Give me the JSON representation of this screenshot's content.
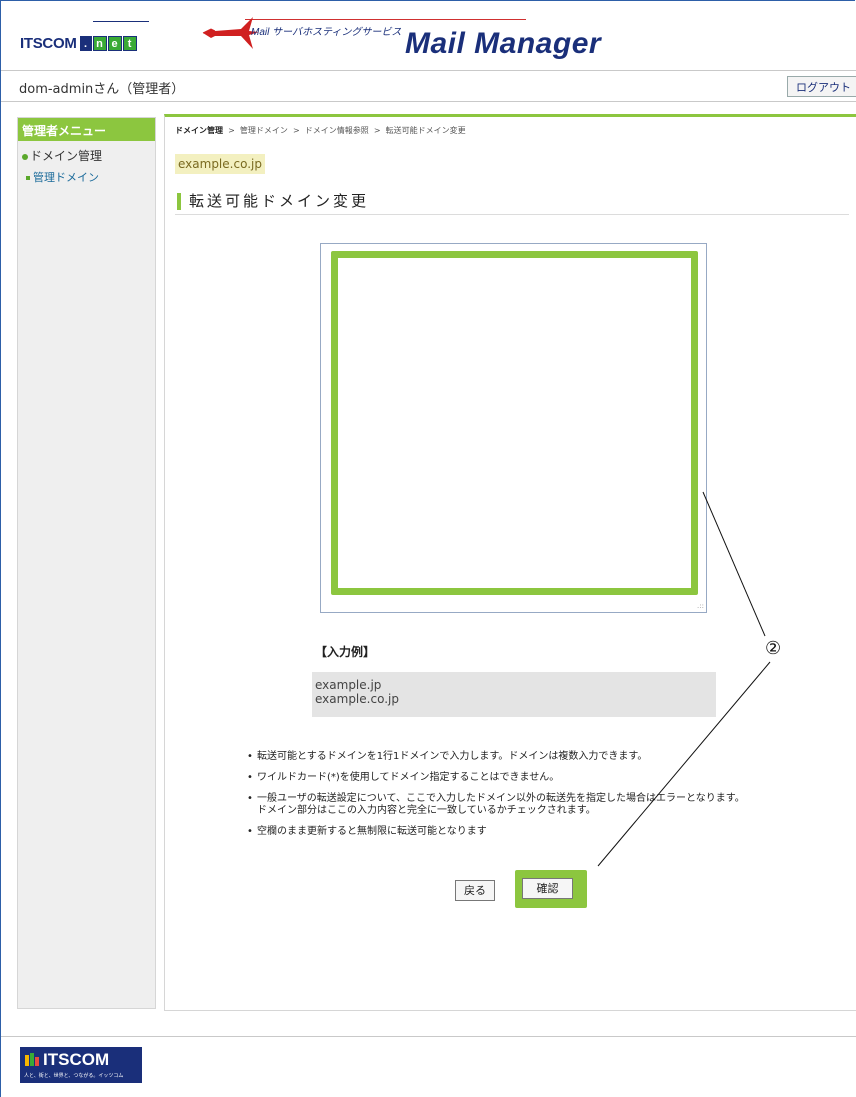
{
  "header": {
    "brand": "ITSCOM",
    "net_letters": [
      ".",
      "n",
      "e",
      "t"
    ],
    "tagline": "Mail サーバホスティングサービス",
    "app_title": "Mail Manager"
  },
  "userbar": {
    "user": "dom-adminさん（管理者）",
    "logout": "ログアウト"
  },
  "sidebar": {
    "heading": "管理者メニュー",
    "section": "ドメイン管理",
    "item": "管理ドメイン"
  },
  "main": {
    "breadcrumb": [
      "ドメイン管理",
      "管理ドメイン",
      "ドメイン情報参照",
      "転送可能ドメイン変更"
    ],
    "breadcrumb_sep": ">",
    "domain": "example.co.jp",
    "heading": "転送可能ドメイン変更",
    "textarea_value": "",
    "example_label": "【入力例】",
    "example_lines": [
      "example.jp",
      "example.co.jp"
    ],
    "notes": [
      "転送可能とするドメインを1行1ドメインで入力します。ドメインは複数入力できます。",
      "ワイルドカード(*)を使用してドメイン指定することはできません。",
      "一般ユーザの転送設定について、ここで入力したドメイン以外の転送先を指定した場合はエラーとなります。",
      "ドメイン部分はここの入力内容と完全に一致しているかチェックされます。",
      "空欄のまま更新すると無制限に転送可能となります"
    ],
    "back_button": "戻る",
    "confirm_button": "確認"
  },
  "annotation": {
    "number": "②",
    "highlight_color": "#8cc63f"
  },
  "footer": {
    "brand": "ITSCOM",
    "slogan": "人と、街と、世界と、つながる。イッツコム"
  }
}
